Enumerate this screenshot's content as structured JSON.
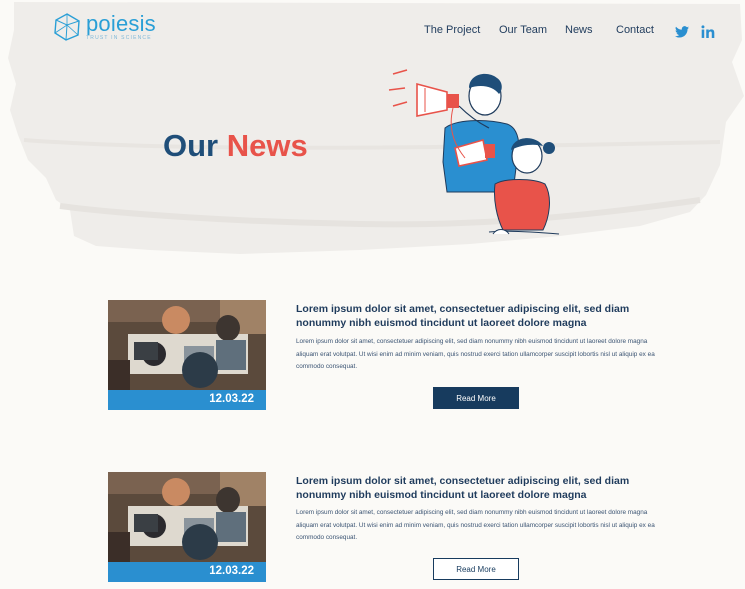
{
  "header": {
    "logo_name": "poiesis",
    "logo_tagline": "TRUST IN SCIENCE",
    "nav": [
      {
        "label": "The Project"
      },
      {
        "label": "Our Team"
      },
      {
        "label": "News"
      },
      {
        "label": "Contact"
      }
    ],
    "social_icons": [
      "twitter-icon",
      "linkedin-icon"
    ]
  },
  "hero": {
    "title_part1": "Our",
    "title_part2": "News"
  },
  "articles": [
    {
      "title": "Lorem ipsum dolor sit amet, consectetuer adipiscing elit, sed diam nonummy nibh euismod tincidunt ut laoreet dolore magna",
      "body": "Lorem ipsum dolor sit amet, consectetuer adipiscing elit, sed diam nonummy nibh euismod tincidunt ut laoreet dolore magna aliquam erat volutpat. Ut wisi enim ad minim veniam, quis nostrud exerci tation ullamcorper suscipit lobortis nisl ut aliquip ex ea commodo consequat.",
      "date": "12.03.22",
      "button": "Read More"
    },
    {
      "title": "Lorem ipsum dolor sit amet, consectetuer adipiscing elit, sed diam nonummy nibh euismod tincidunt ut laoreet dolore magna",
      "body": "Lorem ipsum dolor sit amet, consectetuer adipiscing elit, sed diam nonummy nibh euismod tincidunt ut laoreet dolore magna aliquam erat volutpat. Ut wisi enim ad minim veniam, quis nostrud exerci tation ullamcorper suscipit lobortis nisl ut aliquip ex ea commodo consequat.",
      "date": "12.03.22",
      "button": "Read More"
    }
  ],
  "colors": {
    "brand_blue": "#2a9fd6",
    "navy": "#1f3b5c",
    "accent_red": "#e8534a",
    "button_navy": "#173b5e",
    "date_bar": "#2a8fd0"
  }
}
